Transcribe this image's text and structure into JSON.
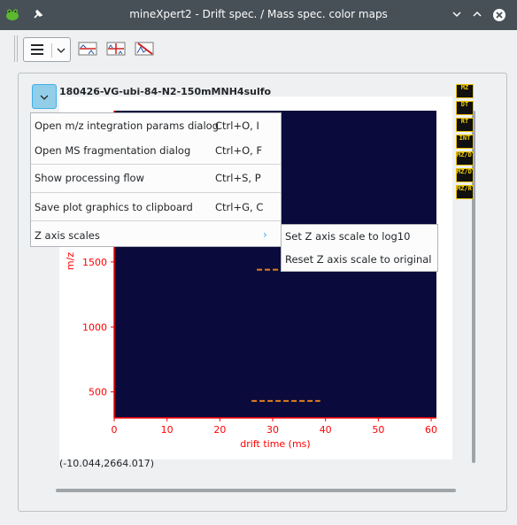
{
  "window": {
    "title": "mineXpert2 - Drift spec. / Mass spec. color maps"
  },
  "pane": {
    "title": "180426-VG-ubi-84-N2-150mMNH4sulfo",
    "coords": "(-10.044,2664.017)",
    "side_icons": [
      "MZ",
      "DT",
      "RT",
      "INT",
      "MZ/DT",
      "MZ/DT",
      "MZ/RT"
    ]
  },
  "context_menu": {
    "items": [
      {
        "label": "Open m/z integration params dialog",
        "shortcut": "Ctrl+O, I"
      },
      {
        "label": "Open MS fragmentation dialog",
        "shortcut": "Ctrl+O, F"
      },
      {
        "label": "Show processing flow",
        "shortcut": "Ctrl+S, P"
      },
      {
        "label": "Save plot graphics to clipboard",
        "shortcut": "Ctrl+G, C"
      },
      {
        "label": "Z axis scales",
        "shortcut": ""
      }
    ]
  },
  "submenu": {
    "items": [
      {
        "label": "Set Z axis scale to log10"
      },
      {
        "label": "Reset Z axis scale to original"
      }
    ]
  },
  "colors": {
    "titlebar": "#475057",
    "plot_background": "#0a0a3c",
    "axis": "#ff0000",
    "accent": "#3daee9"
  },
  "chart_data": {
    "type": "heatmap",
    "title": "",
    "xlabel": "drift time (ms)",
    "ylabel": "m/z",
    "xlim": [
      0,
      61
    ],
    "ylim": [
      300,
      2664
    ],
    "x_ticks": [
      "0",
      "10",
      "20",
      "30",
      "40",
      "50",
      "60"
    ],
    "y_ticks": [
      "500",
      "1000",
      "1500"
    ],
    "x_tick_values": [
      0,
      10,
      20,
      30,
      40,
      50,
      60
    ],
    "y_tick_values": [
      500,
      1000,
      1500
    ],
    "traces": [
      {
        "x0": 27,
        "x1": 41,
        "y": 1440
      },
      {
        "x0": 26,
        "x1": 39,
        "y": 430
      }
    ]
  }
}
